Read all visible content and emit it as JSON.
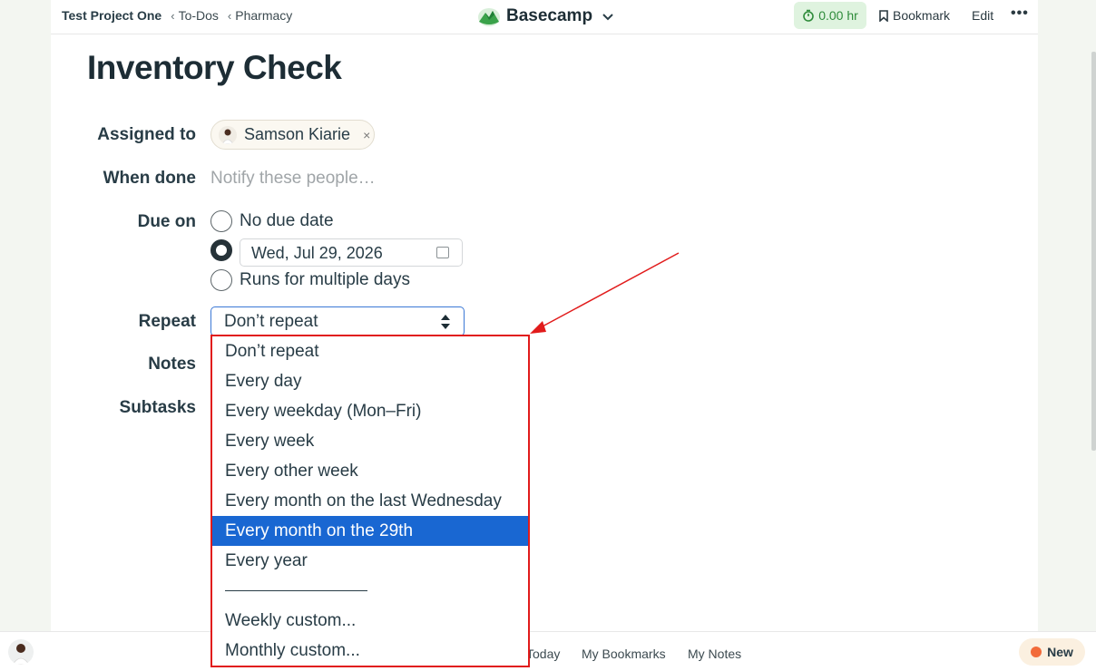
{
  "breadcrumb": {
    "project": "Test Project One",
    "sep": "‹",
    "todos": "To-Dos",
    "list": "Pharmacy"
  },
  "brand": {
    "name": "Basecamp"
  },
  "toolbar": {
    "timer": "0.00 hr",
    "bookmark": "Bookmark",
    "edit": "Edit",
    "more": "•••"
  },
  "todo": {
    "title": "Inventory Check",
    "labels": {
      "assigned": "Assigned to",
      "when_done": "When done",
      "due_on": "Due on",
      "repeat": "Repeat",
      "notes": "Notes",
      "subtasks": "Subtasks"
    },
    "assignee": "Samson Kiarie",
    "remove_glyph": "×",
    "notify_placeholder": "Notify these people…",
    "due_options": {
      "none": "No due date",
      "date": "Wed, Jul 29, 2026",
      "multi": "Runs for multiple days"
    },
    "repeat_value": "Don’t repeat",
    "repeat_options": [
      "Don’t repeat",
      "Every day",
      "Every weekday (Mon–Fri)",
      "Every week",
      "Every other week",
      "Every month on the last Wednesday",
      "Every month on the 29th",
      "Every year",
      "",
      "Weekly custom...",
      "Monthly custom..."
    ],
    "repeat_selected": "Every month on the 29th"
  },
  "bottom": {
    "today": "Today",
    "bookmarks": "My Bookmarks",
    "notes": "My Notes",
    "new": "New"
  },
  "colors": {
    "accent": "#1967d2",
    "highlight_border": "#e11b1b",
    "timer_bg": "#dff3df",
    "timer_text": "#2e8b3a",
    "new_dot": "#f26b3a"
  }
}
